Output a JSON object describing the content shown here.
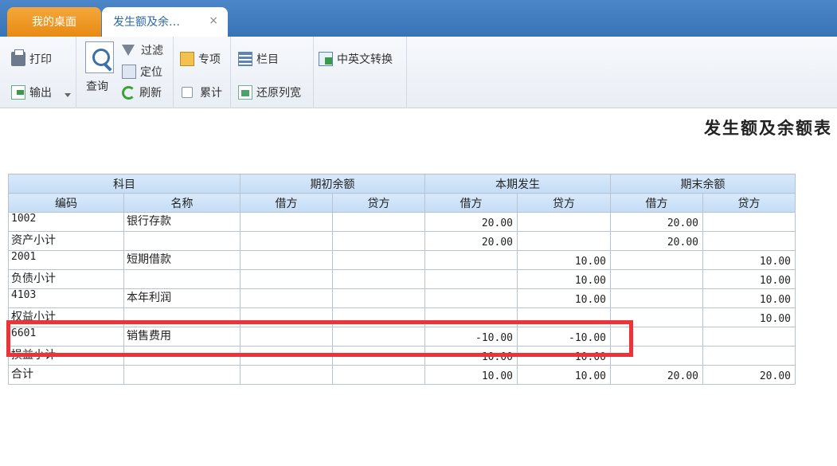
{
  "tabs": [
    {
      "label": "我的桌面"
    },
    {
      "label": "发生额及余…",
      "close": "×"
    }
  ],
  "toolbar": {
    "print": "打印",
    "export": "输出",
    "query": "查询",
    "filter": "过滤",
    "locate": "定位",
    "refresh": "刷新",
    "special": "专项",
    "cumulative": "累计",
    "columns": "栏目",
    "restore_width": "还原列宽",
    "lang_switch": "中英文转换"
  },
  "report": {
    "title": "发生额及余额表"
  },
  "table": {
    "group_headers": [
      "科目",
      "期初余额",
      "本期发生",
      "期末余额"
    ],
    "sub_headers": [
      "编码",
      "名称",
      "借方",
      "贷方",
      "借方",
      "贷方",
      "借方",
      "贷方"
    ],
    "rows": [
      [
        "1002",
        "银行存款",
        "",
        "",
        "20.00",
        "",
        "20.00",
        ""
      ],
      [
        "资产小计",
        "",
        "",
        "",
        "20.00",
        "",
        "20.00",
        ""
      ],
      [
        "2001",
        "短期借款",
        "",
        "",
        "",
        "10.00",
        "",
        "10.00"
      ],
      [
        "负债小计",
        "",
        "",
        "",
        "",
        "10.00",
        "",
        "10.00"
      ],
      [
        "4103",
        "本年利润",
        "",
        "",
        "",
        "10.00",
        "",
        "10.00"
      ],
      [
        "权益小计",
        "",
        "",
        "",
        "",
        "",
        "",
        "10.00"
      ],
      [
        "6601",
        "销售费用",
        "",
        "",
        "-10.00",
        "-10.00",
        "",
        ""
      ],
      [
        "损益小计",
        "",
        "",
        "",
        "10.00",
        "10.00",
        "",
        ""
      ],
      [
        "合计",
        "",
        "",
        "",
        "10.00",
        "10.00",
        "20.00",
        "20.00"
      ]
    ]
  },
  "highlight": {
    "color": "#ee3338",
    "row": 7
  }
}
